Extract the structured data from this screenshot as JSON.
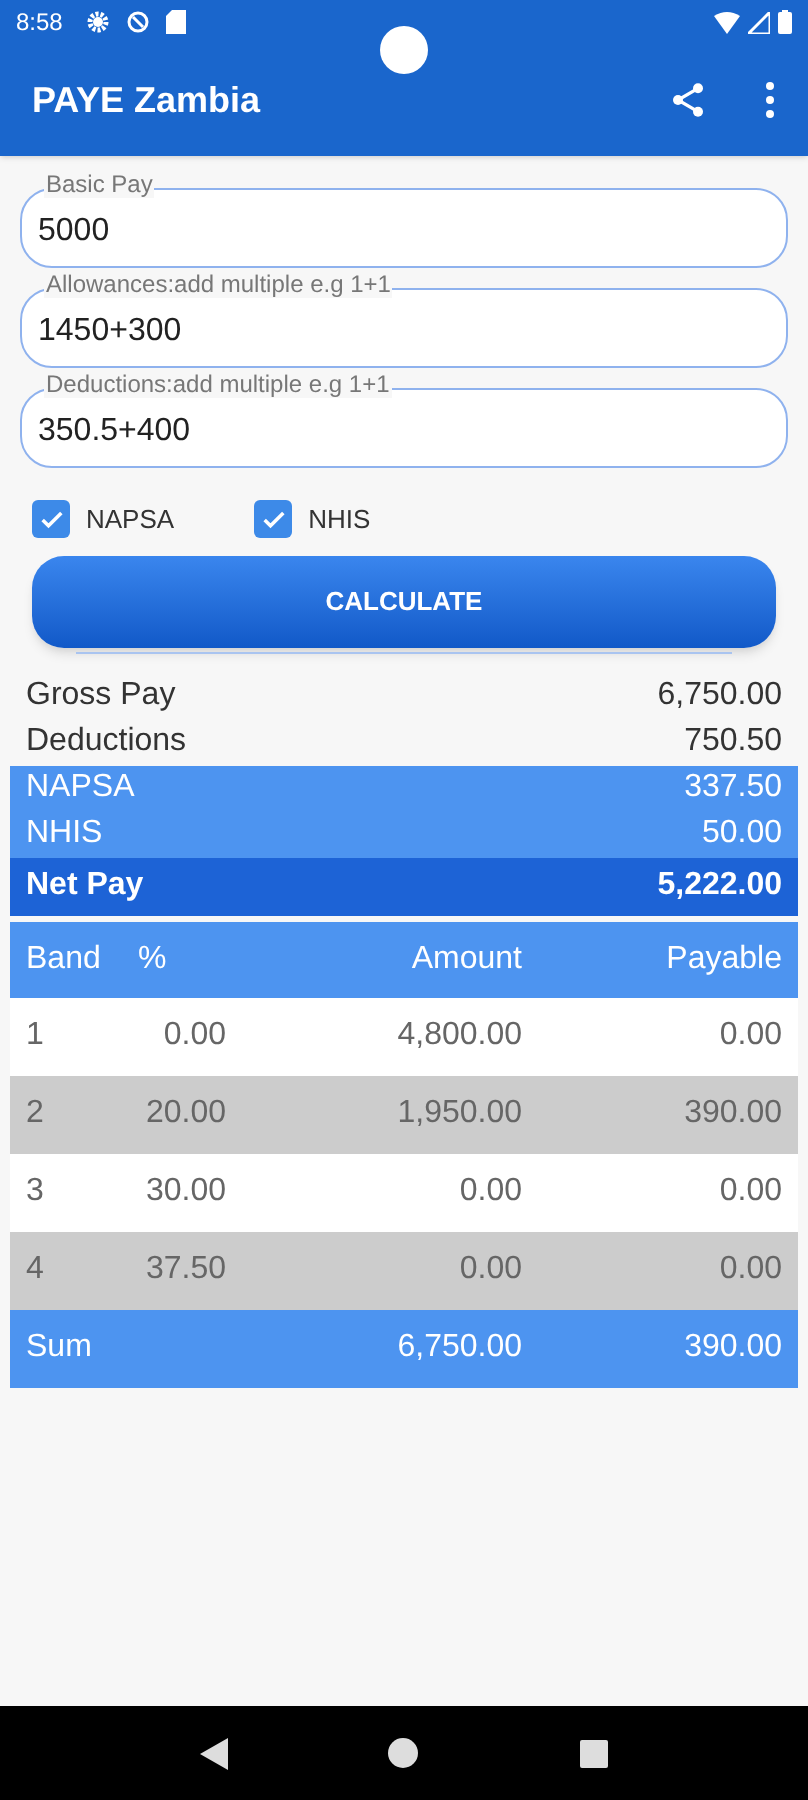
{
  "status_bar": {
    "time": "8:58"
  },
  "app_bar": {
    "title": "PAYE Zambia"
  },
  "fields": [
    {
      "label": "Basic Pay",
      "value": "5000"
    },
    {
      "label": "Allowances:add multiple e.g 1+1",
      "value": "1450+300"
    },
    {
      "label": "Deductions:add multiple e.g 1+1",
      "value": "350.5+400"
    }
  ],
  "checkboxes": [
    {
      "label": "NAPSA",
      "checked": true
    },
    {
      "label": "NHIS",
      "checked": true
    }
  ],
  "calculate_button": "CALCULATE",
  "summary": [
    {
      "kind": "plain",
      "label": "Gross Pay",
      "value": "6,750.00"
    },
    {
      "kind": "plain",
      "label": "Deductions",
      "value": "750.50"
    },
    {
      "kind": "levy",
      "label": "NAPSA",
      "value": "337.50"
    },
    {
      "kind": "levy",
      "label": "NHIS",
      "value": "50.00"
    },
    {
      "kind": "net",
      "label": "Net Pay",
      "value": "5,222.00"
    }
  ],
  "table": {
    "columns": [
      "Band",
      "%",
      "Amount",
      "Payable"
    ],
    "rows": [
      [
        "1",
        "0.00",
        "4,800.00",
        "0.00"
      ],
      [
        "2",
        "20.00",
        "1,950.00",
        "390.00"
      ],
      [
        "3",
        "30.00",
        "0.00",
        "0.00"
      ],
      [
        "4",
        "37.50",
        "0.00",
        "0.00"
      ]
    ],
    "sum": [
      "Sum",
      "6,750.00",
      "390.00"
    ]
  }
}
